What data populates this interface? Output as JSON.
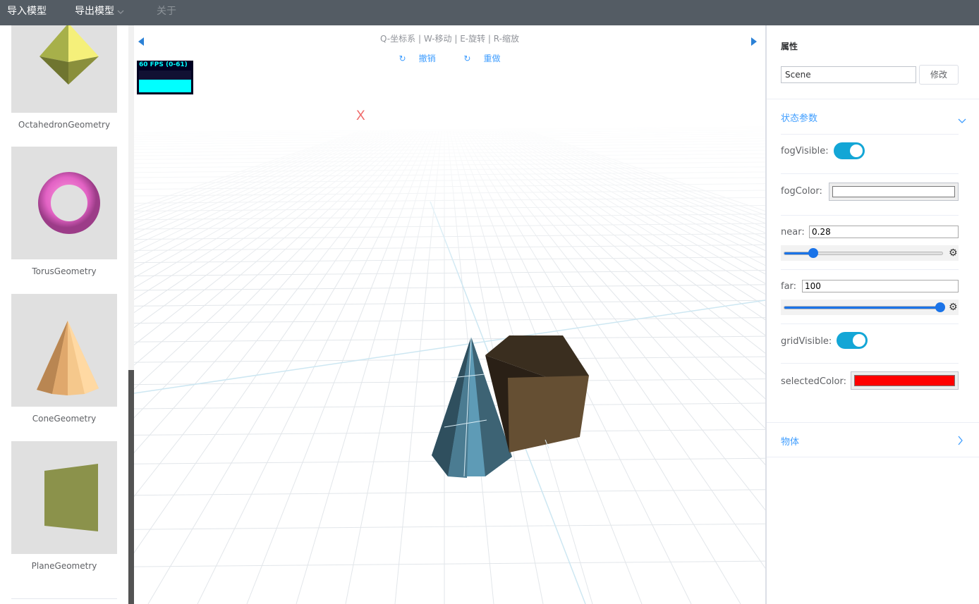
{
  "menu": {
    "import_label": "导入模型",
    "export_label": "导出模型",
    "about_label": "关于"
  },
  "library": {
    "items": [
      {
        "label": "OctahedronGeometry"
      },
      {
        "label": "TorusGeometry"
      },
      {
        "label": "ConeGeometry"
      },
      {
        "label": "PlaneGeometry"
      }
    ]
  },
  "viewport": {
    "hint": "Q-坐标系 | W-移动 | E-旋转 | R-缩放",
    "undo_label": "撤销",
    "redo_label": "重做",
    "undo_icon": "↻",
    "redo_icon": "↻",
    "fps_text": "60 FPS (0-61)",
    "axis_marker": "X"
  },
  "panel": {
    "title": "属性",
    "name_value": "Scene",
    "modify_label": "修改",
    "state_section_title": "状态参数",
    "fog_visible_label": "fogVisible:",
    "fog_visible": true,
    "fog_color_label": "fogColor:",
    "fog_color": "#ffffff",
    "near_label": "near:",
    "near_value": "0.28",
    "near_slider_fraction": 0.17,
    "far_label": "far:",
    "far_value": "100",
    "far_slider_fraction": 1.0,
    "grid_visible_label": "gridVisible:",
    "grid_visible": true,
    "selected_color_label": "selectedColor:",
    "selected_color": "#ff0000",
    "objects_section_title": "物体"
  },
  "colors": {
    "topbar": "#545c64",
    "accent": "#409eff",
    "toggle": "#13a6d6"
  }
}
